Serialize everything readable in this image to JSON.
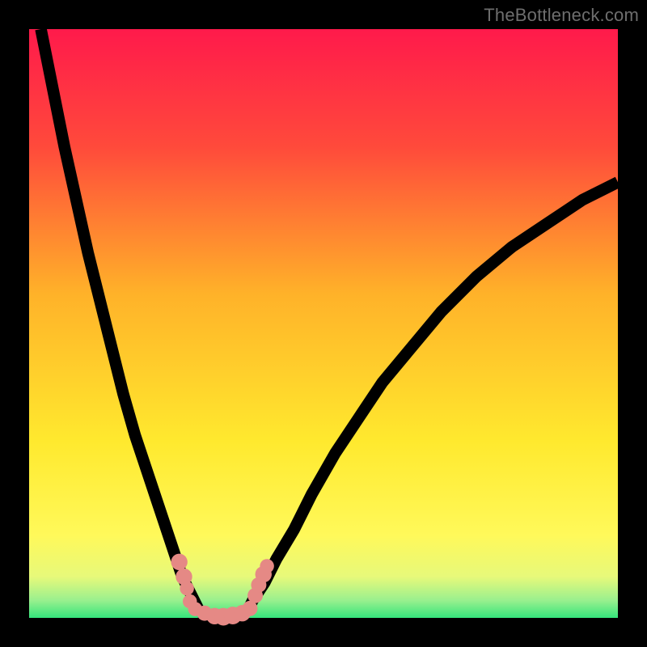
{
  "watermark": "TheBottleneck.com",
  "colors": {
    "frame_bg": "#000000",
    "curve": "#000000",
    "dots": "#e58985",
    "gradient_stops": [
      {
        "pct": 0,
        "color": "#ff1a4b"
      },
      {
        "pct": 20,
        "color": "#ff4a3b"
      },
      {
        "pct": 45,
        "color": "#ffb229"
      },
      {
        "pct": 70,
        "color": "#ffe92e"
      },
      {
        "pct": 86,
        "color": "#fff95a"
      },
      {
        "pct": 93,
        "color": "#e7f97a"
      },
      {
        "pct": 97,
        "color": "#9af08e"
      },
      {
        "pct": 100,
        "color": "#35e57c"
      }
    ]
  },
  "plot_gradient_css": "linear-gradient(to bottom, #ff1a4b 0%, #ff4a3b 20%, #ffb229 45%, #ffe92e 70%, #fff95a 86%, #e7f97a 93%, #9af08e 97%, #35e57c 100%)",
  "chart_data": {
    "type": "line",
    "title": "",
    "xlabel": "",
    "ylabel": "",
    "xlim": [
      0,
      100
    ],
    "ylim": [
      0,
      100
    ],
    "grid": false,
    "annotations": [],
    "series": [
      {
        "name": "left-branch",
        "x": [
          2,
          4,
          6,
          8,
          10,
          12,
          14,
          16,
          18,
          20,
          22,
          24,
          25,
          26,
          27,
          28,
          29
        ],
        "y": [
          100,
          90,
          80,
          71,
          62,
          54,
          46,
          38,
          31,
          25,
          19,
          13,
          10,
          7,
          5,
          3,
          1
        ]
      },
      {
        "name": "right-branch",
        "x": [
          37,
          38,
          40,
          42,
          45,
          48,
          52,
          56,
          60,
          65,
          70,
          76,
          82,
          88,
          94,
          100
        ],
        "y": [
          1,
          3,
          6,
          10,
          15,
          21,
          28,
          34,
          40,
          46,
          52,
          58,
          63,
          67,
          71,
          74
        ]
      },
      {
        "name": "valley-floor",
        "x": [
          29,
          31,
          33,
          35,
          37
        ],
        "y": [
          1,
          0.3,
          0.1,
          0.3,
          1
        ]
      }
    ],
    "scatter": {
      "name": "highlighted-dots",
      "points": [
        {
          "x": 25.5,
          "y": 9.5,
          "r": 1.4
        },
        {
          "x": 26.3,
          "y": 7.0,
          "r": 1.4
        },
        {
          "x": 26.8,
          "y": 5.0,
          "r": 1.2
        },
        {
          "x": 27.3,
          "y": 2.8,
          "r": 1.2
        },
        {
          "x": 28.2,
          "y": 1.5,
          "r": 1.2
        },
        {
          "x": 29.8,
          "y": 0.8,
          "r": 1.3
        },
        {
          "x": 31.5,
          "y": 0.3,
          "r": 1.4
        },
        {
          "x": 33.0,
          "y": 0.2,
          "r": 1.5
        },
        {
          "x": 34.6,
          "y": 0.4,
          "r": 1.5
        },
        {
          "x": 36.2,
          "y": 0.8,
          "r": 1.4
        },
        {
          "x": 37.5,
          "y": 1.6,
          "r": 1.3
        },
        {
          "x": 38.4,
          "y": 3.8,
          "r": 1.3
        },
        {
          "x": 39.0,
          "y": 5.6,
          "r": 1.3
        },
        {
          "x": 39.8,
          "y": 7.4,
          "r": 1.4
        },
        {
          "x": 40.4,
          "y": 8.8,
          "r": 1.2
        }
      ]
    }
  }
}
